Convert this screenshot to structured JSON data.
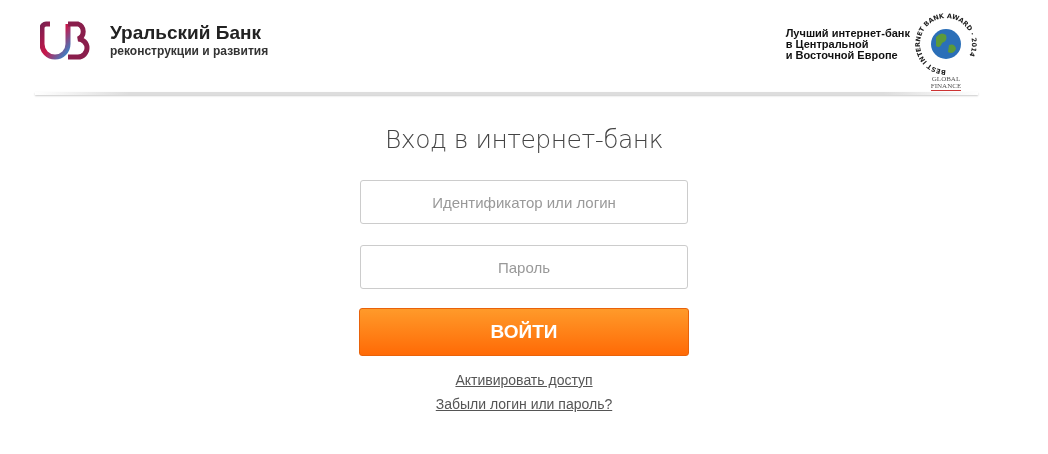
{
  "header": {
    "bank_name": "Уральский Банк",
    "bank_subtitle": "реконструкции и развития",
    "award_text": [
      "Лучший интернет-банк",
      "в Центральной",
      "и Восточной Европе"
    ],
    "award_ring": "BEST INTERNET BANK AWARD · 2014",
    "award_brand": [
      "GLOBAL",
      "FINANCE"
    ]
  },
  "login": {
    "title": "Вход в интернет-банк",
    "fields": [
      {
        "placeholder": "Идентификатор или логин"
      },
      {
        "placeholder": "Пароль"
      }
    ],
    "submit": "ВОЙТИ",
    "links": [
      "Активировать доступ",
      "Забыли логин или пароль?"
    ]
  }
}
